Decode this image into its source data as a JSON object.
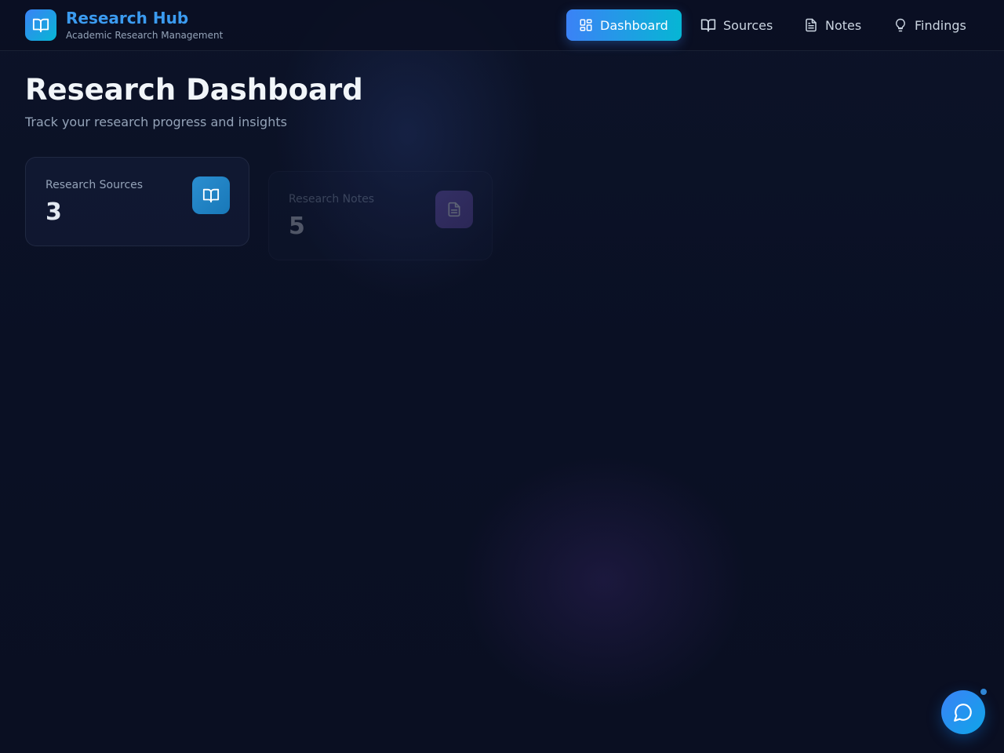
{
  "app": {
    "title": "Research Hub",
    "subtitle": "Academic Research Management",
    "logo_icon": "book-open-icon"
  },
  "nav": {
    "items": [
      {
        "label": "Dashboard",
        "icon": "grid-icon",
        "active": true
      },
      {
        "label": "Sources",
        "icon": "book-open-icon",
        "active": false
      },
      {
        "label": "Notes",
        "icon": "document-icon",
        "active": false
      },
      {
        "label": "Findings",
        "icon": "lightbulb-icon",
        "active": false
      }
    ]
  },
  "page": {
    "title": "Research Dashboard",
    "subtitle": "Track your research progress and insights"
  },
  "stats": [
    {
      "label": "Research Sources",
      "value": "3",
      "icon": "book-open-icon",
      "color": "#2b8ed0"
    },
    {
      "label": "Research Notes",
      "value": "5",
      "icon": "document-icon",
      "color": "#7c5cc4"
    }
  ],
  "chat": {
    "icon": "chat-bubble-icon",
    "has_notification": true
  },
  "colors": {
    "accent_start": "#3b82f6",
    "accent_end": "#06b6d4",
    "background": "#0a1024",
    "brand_text": "#3b9bf0"
  }
}
